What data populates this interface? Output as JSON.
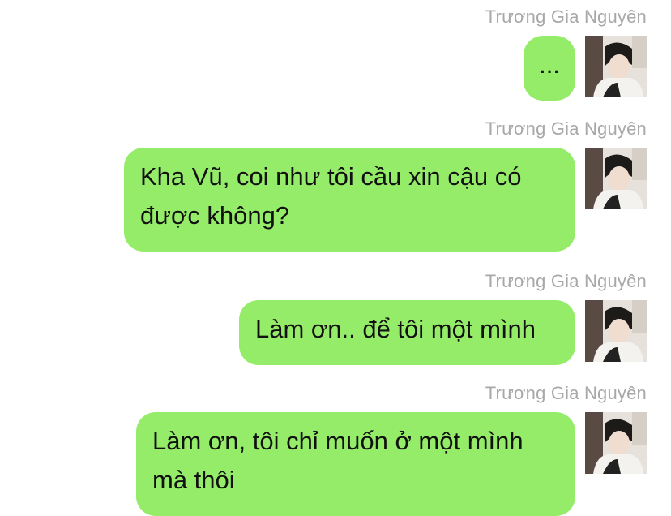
{
  "messages": [
    {
      "sender": "Trương Gia Nguyên",
      "text": "..."
    },
    {
      "sender": "Trương Gia Nguyên",
      "text": "Kha Vũ, coi như tôi cầu xin cậu có được không?"
    },
    {
      "sender": "Trương Gia Nguyên",
      "text": "Làm ơn.. để tôi một mình"
    },
    {
      "sender": "Trương Gia Nguyên",
      "text": "Làm ơn, tôi chỉ muốn ở một mình mà thôi"
    }
  ],
  "colors": {
    "bubble": "#95ec69",
    "sender_name": "#a8a8a8",
    "text": "#111111"
  },
  "avatar_icon": "avatar-photo-icon"
}
